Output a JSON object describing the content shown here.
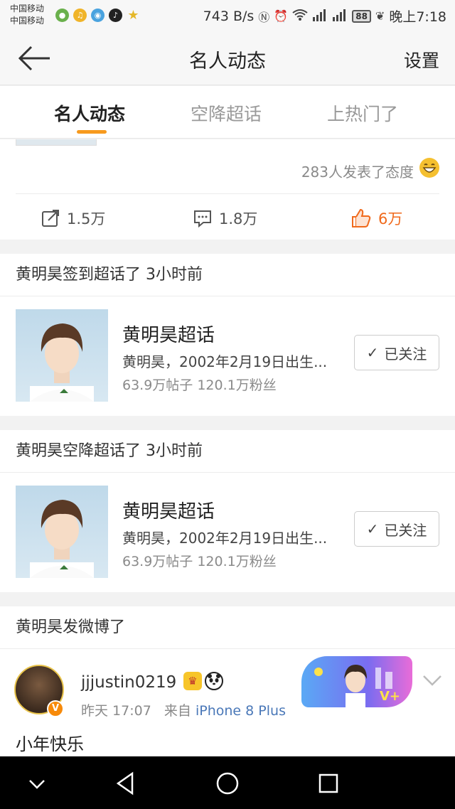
{
  "status_bar": {
    "carrier_1": "中国移动",
    "carrier_2": "中国移动",
    "speed": "743 B/s",
    "battery": "88",
    "time": "晚上7:18",
    "icons": [
      "nfc-icon",
      "alarm-icon",
      "wifi-icon",
      "signal-icon",
      "signal-icon"
    ]
  },
  "header": {
    "back_icon": "back-arrow-icon",
    "title": "名人动态",
    "settings": "设置"
  },
  "tabs": [
    {
      "label": "名人动态",
      "active": true
    },
    {
      "label": "空降超话",
      "active": false
    },
    {
      "label": "上热门了",
      "active": false
    }
  ],
  "card1": {
    "reactions": "283人发表了态度",
    "share_count": "1.5万",
    "comment_count": "1.8万",
    "like_count": "6万"
  },
  "sections": [
    {
      "title": "黄明昊签到超话了 3小时前",
      "topic": {
        "name": "黄明昊超话",
        "desc": "黄明昊，2002年2月19日出生...",
        "stats": "63.9万帖子  120.1万粉丝",
        "follow_label": "已关注"
      }
    },
    {
      "title": "黄明昊空降超话了 3小时前",
      "topic": {
        "name": "黄明昊超话",
        "desc": "黄明昊，2002年2月19日出生...",
        "stats": "63.9万帖子  120.1万粉丝",
        "follow_label": "已关注"
      }
    },
    {
      "title": "黄明昊发微博了"
    }
  ],
  "post": {
    "username": "jjjustin0219",
    "time": "昨天 17:07",
    "source_prefix": "来自",
    "device": "iPhone 8 Plus",
    "text": "小年快乐",
    "verified": "V"
  },
  "colors": {
    "accent": "#f79a1e",
    "like": "#f0691b",
    "link": "#4a78b8"
  }
}
